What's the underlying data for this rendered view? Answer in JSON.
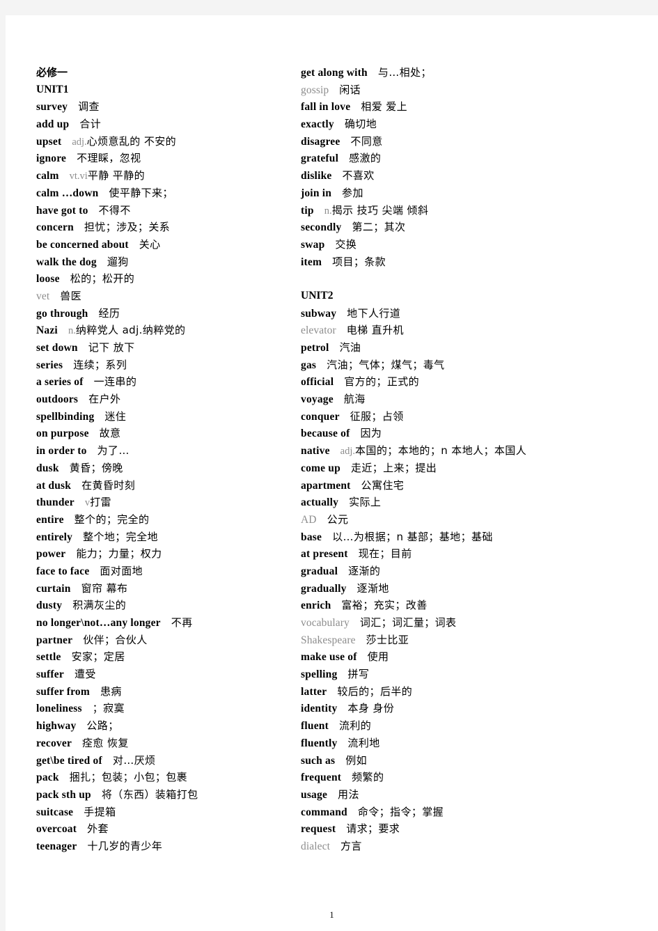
{
  "document": {
    "book_title": "必修一",
    "page_number": "1"
  },
  "left_column": [
    {
      "kind": "heading_cn",
      "en": "必修一"
    },
    {
      "kind": "heading",
      "en": "UNIT1"
    },
    {
      "kind": "entry",
      "en": "survey",
      "pos": "",
      "cn": "调查"
    },
    {
      "kind": "entry",
      "en": "add up",
      "pos": "",
      "cn": "合计"
    },
    {
      "kind": "entry",
      "en": "upset",
      "pos": "adj.",
      "cn": "心烦意乱的 不安的"
    },
    {
      "kind": "entry",
      "en": "ignore",
      "pos": "",
      "cn": "不理睬，忽视"
    },
    {
      "kind": "entry",
      "en": "calm",
      "pos": "vt.vi",
      "cn": "平静 平静的"
    },
    {
      "kind": "entry",
      "en": "calm …down",
      "pos": "",
      "cn": "使平静下来；"
    },
    {
      "kind": "entry",
      "en": "have got to",
      "pos": "",
      "cn": "不得不"
    },
    {
      "kind": "entry",
      "en": "concern",
      "pos": "",
      "cn": "担忧；涉及；关系"
    },
    {
      "kind": "entry",
      "en": "be concerned about",
      "pos": "",
      "cn": "关心"
    },
    {
      "kind": "entry",
      "en": "walk the dog",
      "pos": "",
      "cn": "遛狗"
    },
    {
      "kind": "entry",
      "en": "loose",
      "pos": "",
      "cn": "松的；松开的"
    },
    {
      "kind": "entry_faint",
      "en": "vet",
      "pos": "",
      "cn": "兽医"
    },
    {
      "kind": "entry",
      "en": "go through",
      "pos": "",
      "cn": "经历"
    },
    {
      "kind": "entry",
      "en": "Nazi",
      "pos": "n.",
      "cn": "纳粹党人 adj.纳粹党的"
    },
    {
      "kind": "entry",
      "en": "set down",
      "pos": "",
      "cn": "记下 放下"
    },
    {
      "kind": "entry",
      "en": "series",
      "pos": "",
      "cn": "连续；系列"
    },
    {
      "kind": "entry",
      "en": "a series of",
      "pos": "",
      "cn": "一连串的"
    },
    {
      "kind": "entry",
      "en": "outdoors",
      "pos": "",
      "cn": "在户外"
    },
    {
      "kind": "entry",
      "en": "spellbinding",
      "pos": "",
      "cn": "迷住"
    },
    {
      "kind": "entry",
      "en": "on purpose",
      "pos": "",
      "cn": "故意"
    },
    {
      "kind": "entry",
      "en": "in order to",
      "pos": "",
      "cn": "为了…"
    },
    {
      "kind": "entry",
      "en": "dusk",
      "pos": "",
      "cn": "黄昏；傍晚"
    },
    {
      "kind": "entry",
      "en": "at dusk",
      "pos": "",
      "cn": "在黄昏时刻"
    },
    {
      "kind": "entry",
      "en": "thunder",
      "pos": "v",
      "cn": "打雷"
    },
    {
      "kind": "entry",
      "en": "entire",
      "pos": "",
      "cn": "整个的；完全的"
    },
    {
      "kind": "entry",
      "en": "entirely",
      "pos": "",
      "cn": "整个地；完全地"
    },
    {
      "kind": "entry",
      "en": "power",
      "pos": "",
      "cn": "能力；力量；权力"
    },
    {
      "kind": "entry",
      "en": "face to face",
      "pos": "",
      "cn": "面对面地"
    },
    {
      "kind": "entry",
      "en": "curtain",
      "pos": "",
      "cn": "窗帘 幕布"
    },
    {
      "kind": "entry",
      "en": "dusty",
      "pos": "",
      "cn": "积满灰尘的"
    },
    {
      "kind": "entry",
      "en": "no longer\\not…any longer",
      "pos": "",
      "cn": "不再"
    },
    {
      "kind": "entry",
      "en": "partner",
      "pos": "",
      "cn": "伙伴；合伙人"
    },
    {
      "kind": "entry",
      "en": "settle",
      "pos": "",
      "cn": "安家；定居"
    },
    {
      "kind": "entry",
      "en": "suffer",
      "pos": "",
      "cn": "遭受"
    },
    {
      "kind": "entry",
      "en": "suffer from",
      "pos": "",
      "cn": "患病"
    },
    {
      "kind": "entry",
      "en": "loneliness",
      "pos": "",
      "cn": "；寂寞"
    },
    {
      "kind": "entry",
      "en": "highway",
      "pos": "",
      "cn": "公路；"
    },
    {
      "kind": "entry",
      "en": "recover",
      "pos": "",
      "cn": "痊愈 恢复"
    },
    {
      "kind": "entry",
      "en": "get\\be tired of",
      "pos": "",
      "cn": "对…厌烦"
    },
    {
      "kind": "entry",
      "en": "pack",
      "pos": "",
      "cn": "捆扎；包装；小包；包裹"
    },
    {
      "kind": "entry",
      "en": "pack sth up",
      "pos": "",
      "cn": "将（东西）装箱打包"
    },
    {
      "kind": "entry",
      "en": "suitcase",
      "pos": "",
      "cn": "手提箱"
    },
    {
      "kind": "entry",
      "en": "overcoat",
      "pos": "",
      "cn": "外套"
    },
    {
      "kind": "entry",
      "en": "teenager",
      "pos": "",
      "cn": "十几岁的青少年"
    }
  ],
  "right_column": [
    {
      "kind": "entry",
      "en": "get along with",
      "pos": "",
      "cn": "与…相处；"
    },
    {
      "kind": "entry_faint",
      "en": "gossip",
      "pos": "",
      "cn": "闲话"
    },
    {
      "kind": "entry",
      "en": "fall in love",
      "pos": "",
      "cn": "相爱 爱上"
    },
    {
      "kind": "entry",
      "en": "exactly",
      "pos": "",
      "cn": "确切地"
    },
    {
      "kind": "entry",
      "en": "disagree",
      "pos": "",
      "cn": "不同意"
    },
    {
      "kind": "entry",
      "en": "grateful",
      "pos": "",
      "cn": "感激的"
    },
    {
      "kind": "entry",
      "en": "dislike",
      "pos": "",
      "cn": "不喜欢"
    },
    {
      "kind": "entry",
      "en": "join in",
      "pos": "",
      "cn": "参加"
    },
    {
      "kind": "entry",
      "en": "tip",
      "pos": "n.",
      "cn": "揭示 技巧 尖端 倾斜"
    },
    {
      "kind": "entry",
      "en": "secondly",
      "pos": "",
      "cn": "第二；其次"
    },
    {
      "kind": "entry",
      "en": "swap",
      "pos": "",
      "cn": "交换"
    },
    {
      "kind": "entry",
      "en": "item",
      "pos": "",
      "cn": "项目；条款"
    },
    {
      "kind": "blank"
    },
    {
      "kind": "heading",
      "en": "UNIT2"
    },
    {
      "kind": "entry",
      "en": "subway",
      "pos": "",
      "cn": "地下人行道"
    },
    {
      "kind": "entry_faint",
      "en": "elevator",
      "pos": "",
      "cn": "电梯 直升机"
    },
    {
      "kind": "entry",
      "en": "petrol",
      "pos": "",
      "cn": "汽油"
    },
    {
      "kind": "entry",
      "en": "gas",
      "pos": "",
      "cn": "汽油；气体；煤气；毒气"
    },
    {
      "kind": "entry",
      "en": "official",
      "pos": "",
      "cn": "官方的；正式的"
    },
    {
      "kind": "entry",
      "en": "voyage",
      "pos": "",
      "cn": "航海"
    },
    {
      "kind": "entry",
      "en": "conquer",
      "pos": "",
      "cn": "征服；占领"
    },
    {
      "kind": "entry",
      "en": "because of",
      "pos": "",
      "cn": "因为"
    },
    {
      "kind": "entry",
      "en": "native",
      "pos": "adj.",
      "cn": "本国的；本地的；n 本地人；本国人"
    },
    {
      "kind": "entry",
      "en": "come up",
      "pos": "",
      "cn": "走近；上来；提出"
    },
    {
      "kind": "entry",
      "en": "apartment",
      "pos": "",
      "cn": "公寓住宅"
    },
    {
      "kind": "entry",
      "en": "actually",
      "pos": "",
      "cn": "实际上"
    },
    {
      "kind": "entry_faint",
      "en": "AD",
      "pos": "",
      "cn": "公元"
    },
    {
      "kind": "entry",
      "en": "base",
      "pos": "",
      "cn": "以…为根据；n 基部；基地；基础"
    },
    {
      "kind": "entry",
      "en": "at present",
      "pos": "",
      "cn": "现在；目前"
    },
    {
      "kind": "entry",
      "en": "gradual",
      "pos": "",
      "cn": "逐渐的"
    },
    {
      "kind": "entry",
      "en": "gradually",
      "pos": "",
      "cn": "逐渐地"
    },
    {
      "kind": "entry",
      "en": "enrich",
      "pos": "",
      "cn": "富裕；充实；改善"
    },
    {
      "kind": "entry_faint",
      "en": "vocabulary",
      "pos": "",
      "cn": "词汇；词汇量；词表"
    },
    {
      "kind": "entry_faint",
      "en": "Shakespeare",
      "pos": "",
      "cn": "莎士比亚"
    },
    {
      "kind": "entry",
      "en": "make use of",
      "pos": "",
      "cn": "使用"
    },
    {
      "kind": "entry",
      "en": "spelling",
      "pos": "",
      "cn": "拼写"
    },
    {
      "kind": "entry",
      "en": "latter",
      "pos": "",
      "cn": "较后的；后半的"
    },
    {
      "kind": "entry",
      "en": "identity",
      "pos": "",
      "cn": "本身 身份"
    },
    {
      "kind": "entry",
      "en": "fluent",
      "pos": "",
      "cn": "流利的"
    },
    {
      "kind": "entry",
      "en": "fluently",
      "pos": "",
      "cn": "流利地"
    },
    {
      "kind": "entry",
      "en": "such as",
      "pos": "",
      "cn": "例如"
    },
    {
      "kind": "entry",
      "en": "frequent",
      "pos": "",
      "cn": "频繁的"
    },
    {
      "kind": "entry",
      "en": "usage",
      "pos": "",
      "cn": "用法"
    },
    {
      "kind": "entry",
      "en": "command",
      "pos": "",
      "cn": "命令；指令；掌握"
    },
    {
      "kind": "entry",
      "en": "request",
      "pos": "",
      "cn": "请求；要求"
    },
    {
      "kind": "entry_faint",
      "en": "dialect",
      "pos": "",
      "cn": "方言"
    }
  ]
}
